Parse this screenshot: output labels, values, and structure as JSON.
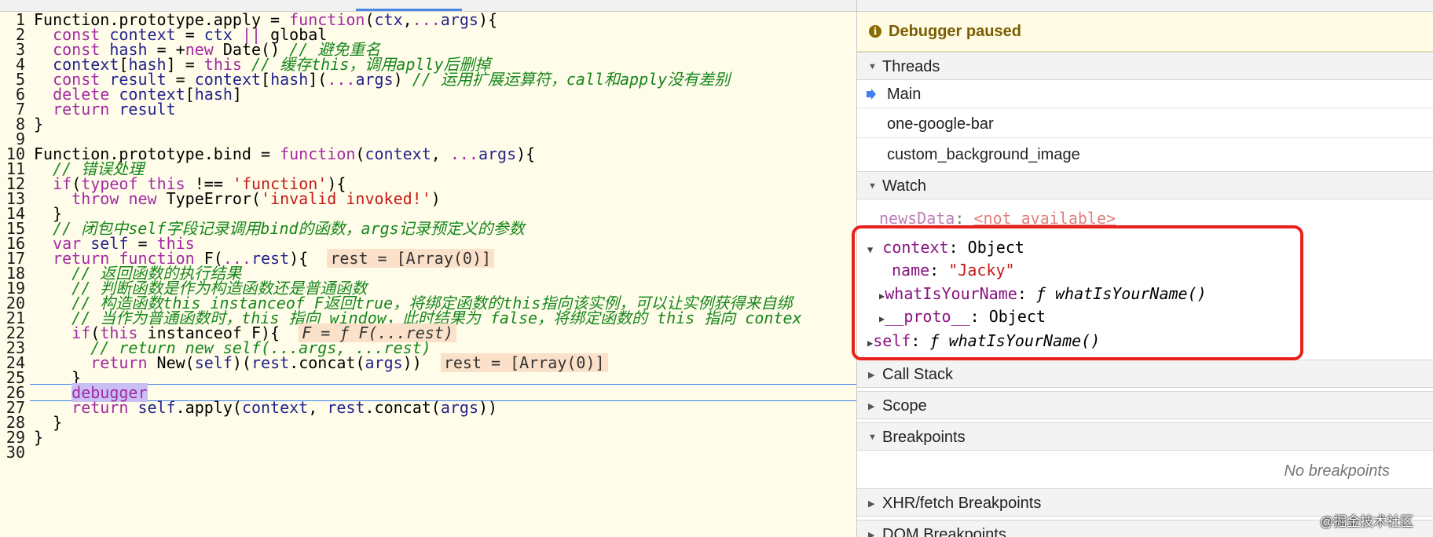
{
  "code": {
    "lines": [
      "Function.prototype.apply = function(ctx,...args){",
      "  const context = ctx || global",
      "  const hash = +new Date() // 避免重名",
      "  context[hash] = this // 缓存this，调用aplly后删掉",
      "  const result = context[hash](...args) // 运用扩展运算符，call和apply没有差别",
      "  delete context[hash]",
      "  return result",
      "}",
      "",
      "Function.prototype.bind = function(context, ...args){",
      "  // 错误处理",
      "  if(typeof this !== 'function'){",
      "    throw new TypeError('invalid invoked!')",
      "  }",
      "  // 闭包中self字段记录调用bind的函数，args记录预定义的参数",
      "  var self = this",
      "  return function F(...rest){",
      "    // 返回函数的执行结果",
      "    // 判断函数是作为构造函数还是普通函数",
      "    // 构造函数this instanceof F返回true，将绑定函数的this指向该实例，可以让实例获得来自绑",
      "    // 当作为普通函数时，this 指向 window，此时结果为 false，将绑定函数的 this 指向 contex",
      "    if(this instanceof F){",
      "      // return new self(...args, ...rest)",
      "      return New(self)(rest.concat(args))",
      "    }",
      "    debugger",
      "    return self.apply(context, rest.concat(args))",
      "  }",
      "}",
      ""
    ],
    "inline_values": {
      "l17": "rest = [Array(0)]",
      "l22": "F = ƒ F(...rest)",
      "l24": "rest = [Array(0)]"
    },
    "current_line": 26
  },
  "debugger": {
    "status": "Debugger paused",
    "sections": {
      "threads": "Threads",
      "watch": "Watch",
      "call_stack": "Call Stack",
      "scope": "Scope",
      "breakpoints": "Breakpoints",
      "xhr": "XHR/fetch Breakpoints",
      "dom": "DOM Breakpoints"
    },
    "threads": [
      "Main",
      "one-google-bar",
      "custom_background_image"
    ],
    "watch": {
      "newsData_key": "newsData",
      "newsData_value": "<not available>",
      "context_key": "context",
      "context_value": "Object",
      "name_key": "name",
      "name_value": "\"Jacky\"",
      "what_key": "whatIsYourName",
      "what_value": "ƒ whatIsYourName()",
      "proto_key": "__proto__",
      "proto_value": "Object",
      "self_key": "self",
      "self_value": "ƒ whatIsYourName()"
    },
    "no_breakpoints": "No breakpoints"
  },
  "watermark": "@掘金技术社区",
  "colors": {
    "keyword": "#a32aa3",
    "comment": "#16861c",
    "string": "#c41a16",
    "highlight_box": "#e8201d"
  }
}
